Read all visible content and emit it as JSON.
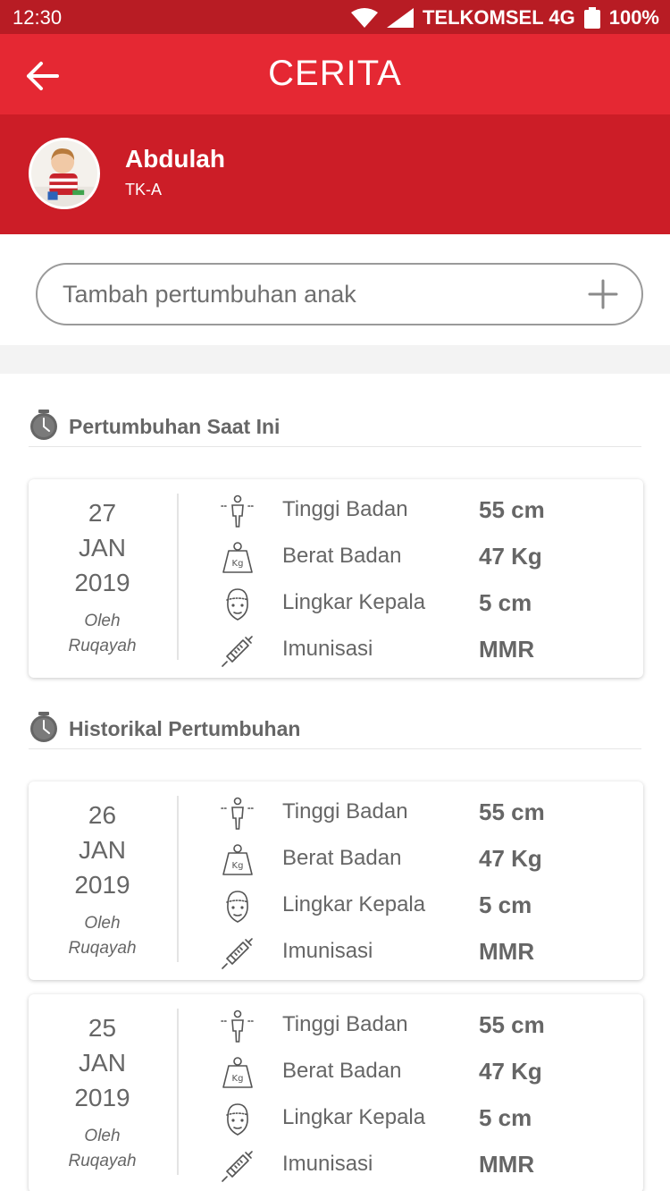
{
  "status_bar": {
    "time": "12:30",
    "carrier": "TELKOMSEL 4G",
    "battery": "100%"
  },
  "app_bar": {
    "title": "CERITA",
    "back_icon": "arrow-left-icon"
  },
  "profile": {
    "name": "Abdulah",
    "class": "TK-A"
  },
  "add_growth": {
    "placeholder": "Tambah pertumbuhan anak",
    "icon": "plus-icon"
  },
  "sections": {
    "current": {
      "label": "Pertumbuhan Saat Ini"
    },
    "history": {
      "label": "Historikal Pertumbuhan"
    }
  },
  "labels": {
    "height": "Tinggi Badan",
    "weight": "Berat Badan",
    "head": "Lingkar Kepala",
    "immunization": "Imunisasi",
    "by": "Oleh"
  },
  "records": [
    {
      "day": "27",
      "month": "JAN",
      "year": "2019",
      "author": "Ruqayah",
      "height": "55 cm",
      "weight": "47 Kg",
      "head": "5 cm",
      "immunization": "MMR"
    },
    {
      "day": "26",
      "month": "JAN",
      "year": "2019",
      "author": "Ruqayah",
      "height": "55 cm",
      "weight": "47 Kg",
      "head": "5 cm",
      "immunization": "MMR"
    },
    {
      "day": "25",
      "month": "JAN",
      "year": "2019",
      "author": "Ruqayah",
      "height": "55 cm",
      "weight": "47 Kg",
      "head": "5 cm",
      "immunization": "MMR"
    }
  ],
  "colors": {
    "status_bar": "#b81c24",
    "app_bar": "#e52833",
    "profile_band": "#cc1d27",
    "text": "#666666"
  }
}
